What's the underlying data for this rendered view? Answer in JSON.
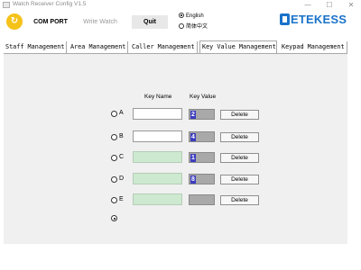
{
  "window": {
    "title": "Watch Receiver Config V1.5",
    "minimize": "—",
    "maximize": "☐",
    "close": "✕"
  },
  "toolbar": {
    "com_port_label": "COM PORT",
    "write_watch_label": "Write Watch",
    "quit_label": "Quit",
    "logo_icon": "refresh-icon",
    "logo_glyph": "↻"
  },
  "language": {
    "english_label": "English",
    "chinese_label": "简体中文",
    "selected": "English"
  },
  "brand": {
    "name": "ETEKESS",
    "color": "#1a73c9"
  },
  "tabs": [
    {
      "label": "Staff Management",
      "active": false
    },
    {
      "label": "Area Management",
      "active": false
    },
    {
      "label": "Caller Management",
      "active": false
    },
    {
      "label": "Key Value Management",
      "active": true
    },
    {
      "label": "Keypad Management",
      "active": false
    }
  ],
  "key_table": {
    "header_name": "Key Name",
    "header_value": "Key Value",
    "delete_label": "Delete",
    "rows": [
      {
        "letter": "A",
        "name": "",
        "value": "2",
        "enabled": true
      },
      {
        "letter": "B",
        "name": "",
        "value": "4",
        "enabled": true
      },
      {
        "letter": "C",
        "name": "",
        "value": "1",
        "enabled": false
      },
      {
        "letter": "D",
        "name": "",
        "value": "8",
        "enabled": false
      },
      {
        "letter": "E",
        "name": "",
        "value": "",
        "enabled": false
      }
    ],
    "selected_radio": "extra"
  },
  "colors": {
    "value_highlight": "#3b3bbf",
    "value_box": "#a9a9a9",
    "disabled_input": "#cde9cf",
    "logo": "#f5c219"
  }
}
